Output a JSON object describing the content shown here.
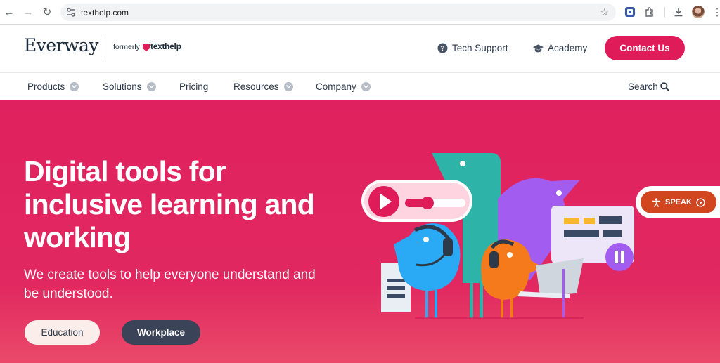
{
  "browser": {
    "url": "texthelp.com"
  },
  "header": {
    "logo": "Everway",
    "formerly": "formerly",
    "texthelp": "texthelp",
    "tech_support": "Tech Support",
    "academy": "Academy",
    "contact": "Contact Us"
  },
  "nav": {
    "items": [
      {
        "label": "Products"
      },
      {
        "label": "Solutions"
      },
      {
        "label": "Pricing"
      },
      {
        "label": "Resources"
      },
      {
        "label": "Company"
      }
    ],
    "search": "Search"
  },
  "hero": {
    "title": "Digital tools for inclusive learning and working",
    "subtitle": "We create tools to help everyone understand and be understood.",
    "btn_education": "Education",
    "btn_workplace": "Workplace"
  },
  "speak": {
    "label": "SPEAK"
  },
  "colors": {
    "brand": "#e01b5a",
    "dark": "#3a4357",
    "speak": "#d1461f"
  }
}
